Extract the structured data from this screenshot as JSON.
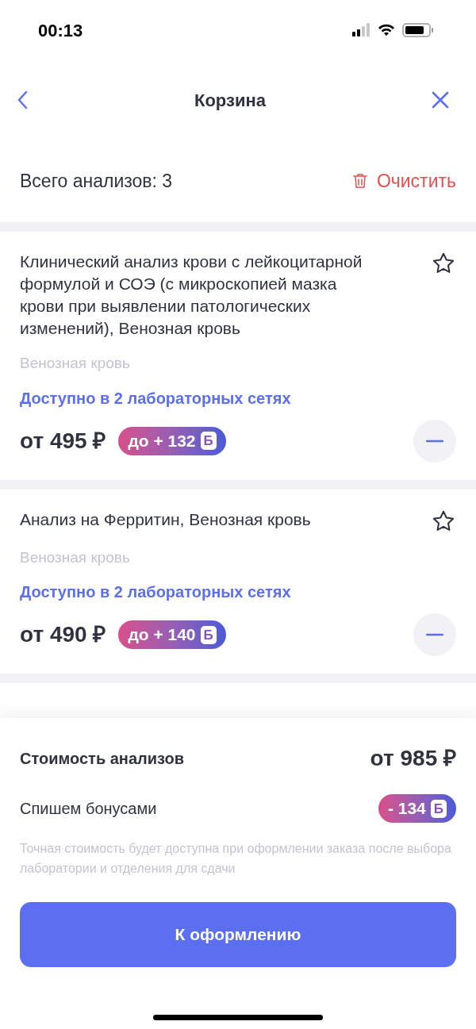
{
  "status_bar": {
    "time": "00:13"
  },
  "header": {
    "title": "Корзина"
  },
  "summary_row": {
    "count_label": "Всего анализов: 3",
    "clear_label": "Очистить"
  },
  "items": [
    {
      "title": "Клинический анализ крови с лейкоцитарной формулой и СОЭ (с микроскопией мазка крови при выявлении патологических изменений), Венозная кровь",
      "biomaterial": "Венозная кровь",
      "availability": "Доступно в 2 лабораторных сетях",
      "price": "от 495 ₽",
      "bonus": "до + 132",
      "bonus_mark": "Б",
      "favorite": false
    },
    {
      "title": "Анализ на Ферритин, Венозная кровь",
      "biomaterial": "Венозная кровь",
      "availability": "Доступно в 2 лабораторных сетях",
      "price": "от 490 ₽",
      "bonus": "до + 140",
      "bonus_mark": "Б",
      "favorite": false
    }
  ],
  "totals": {
    "cost_label": "Стоимость анализов",
    "cost_value": "от 985 ₽",
    "bonus_label": "Спишем бонусами",
    "bonus_value": "- 134",
    "bonus_mark": "Б",
    "note": "Точная стоимость будет доступна при оформлении заказа после выбора лаборатории и отделения для сдачи"
  },
  "checkout_button": "К оформлению"
}
